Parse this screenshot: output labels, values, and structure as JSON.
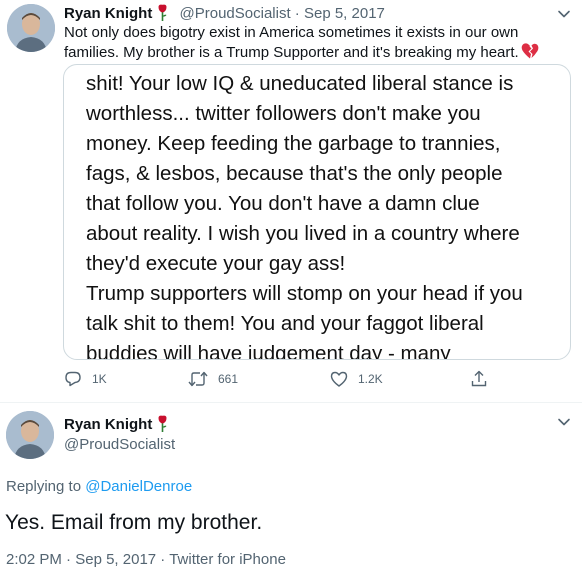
{
  "tweet1": {
    "name": "Ryan Knight",
    "handle": "@ProudSocialist",
    "separator": "·",
    "date": "Sep 5, 2017",
    "text": "Not only does bigotry exist in America sometimes it exists in our own families. My brother is a Trump Supporter and it's breaking my heart.",
    "media_lines": [
      "shit! Your low IQ & uneducated liberal stance is",
      "worthless... twitter followers don't make you",
      "money. Keep feeding the garbage to trannies,",
      "fags, & lesbos, because that's the only people",
      "that follow you.  You don't have a damn clue",
      "about reality. I wish you lived in a country where",
      "they'd execute your gay ass!",
      "Trump supporters will stomp on your head if you",
      "talk shit to them! You and your faggot liberal",
      "buddies will have judgement day - many"
    ],
    "replies": "1K",
    "retweets": "661",
    "likes": "1.2K"
  },
  "tweet2": {
    "name": "Ryan Knight",
    "handle": "@ProudSocialist",
    "replying_prefix": "Replying to",
    "replying_to": "@DanielDenroe",
    "text": "Yes. Email from my brother.",
    "time": "2:02 PM",
    "date": "Sep 5, 2017",
    "source": "Twitter for iPhone",
    "separator": "·"
  },
  "icons": {
    "rose": "rose-emoji",
    "broken_heart": "broken-heart-emoji",
    "reply": "reply-icon",
    "retweet": "retweet-icon",
    "like": "like-icon",
    "share": "share-icon",
    "more": "chevron-down-icon"
  },
  "colors": {
    "text": "#0f1419",
    "muted": "#536471",
    "link": "#1d9bf0",
    "border": "#cfd9de",
    "rose": "#c8102e"
  }
}
